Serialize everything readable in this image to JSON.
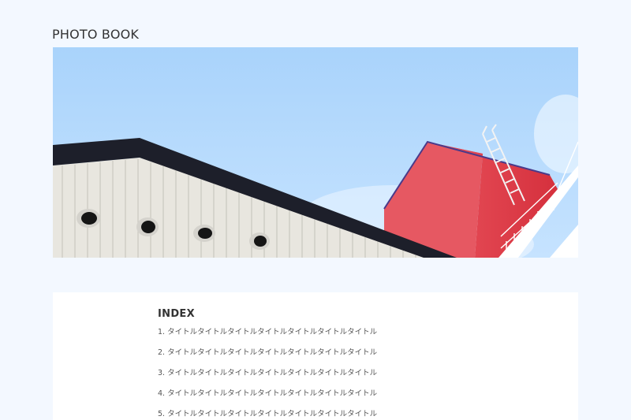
{
  "site": {
    "title": "PHOTO BOOK"
  },
  "hero": {
    "image": "photo-building-roof-red-tower-sky"
  },
  "index": {
    "heading": "INDEX",
    "items": [
      {
        "number": "1.",
        "title": "タイトルタイトルタイトルタイトルタイトルタイトルタイトル"
      },
      {
        "number": "2.",
        "title": "タイトルタイトルタイトルタイトルタイトルタイトルタイトル"
      },
      {
        "number": "3.",
        "title": "タイトルタイトルタイトルタイトルタイトルタイトルタイトル"
      },
      {
        "number": "4.",
        "title": "タイトルタイトルタイトルタイトルタイトルタイトルタイトル"
      },
      {
        "number": "5.",
        "title": "タイトルタイトルタイトルタイトルタイトルタイトルタイトル"
      }
    ]
  },
  "colors": {
    "page_background": "#f3f8ff",
    "card_background": "#ffffff",
    "sky": "#aed6ff",
    "roof": "#1d1f2a",
    "wall": "#e9e7e1",
    "tower_red": "#e0414d"
  }
}
